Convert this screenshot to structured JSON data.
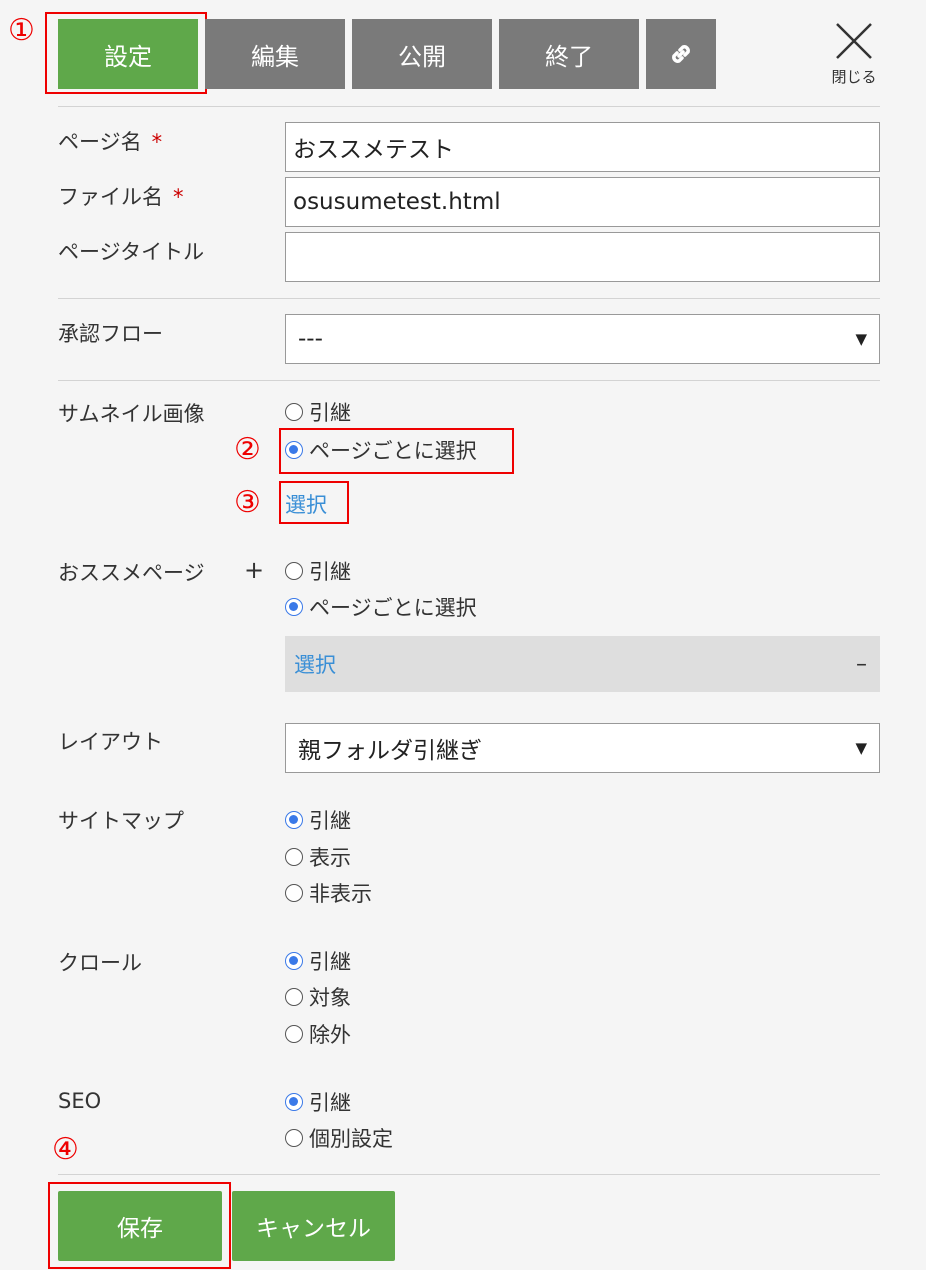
{
  "tabs": {
    "settings": "設定",
    "edit": "編集",
    "publish": "公開",
    "end": "終了"
  },
  "close_label": "閉じる",
  "fields": {
    "page_name_label": "ページ名",
    "page_name_value": "おススメテスト",
    "file_name_label": "ファイル名",
    "file_name_value": "osusumetest.html",
    "page_title_label": "ページタイトル",
    "page_title_value": "",
    "required_mark": "*"
  },
  "approval": {
    "label": "承認フロー",
    "value": "---"
  },
  "thumbnail": {
    "label": "サムネイル画像",
    "opt_inherit": "引継",
    "opt_per_page": "ページごとに選択",
    "select_link": "選択"
  },
  "recommend": {
    "label": "おススメページ",
    "plus": "+",
    "opt_inherit": "引継",
    "opt_per_page": "ページごとに選択",
    "select_link": "選択",
    "minus": "–"
  },
  "layout": {
    "label": "レイアウト",
    "value": "親フォルダ引継ぎ"
  },
  "sitemap": {
    "label": "サイトマップ",
    "opt_inherit": "引継",
    "opt_show": "表示",
    "opt_hide": "非表示"
  },
  "crawl": {
    "label": "クロール",
    "opt_inherit": "引継",
    "opt_target": "対象",
    "opt_exclude": "除外"
  },
  "seo": {
    "label": "SEO",
    "opt_inherit": "引継",
    "opt_custom": "個別設定"
  },
  "buttons": {
    "save": "保存",
    "cancel": "キャンセル"
  },
  "callouts": {
    "c1": "①",
    "c2": "②",
    "c3": "③",
    "c4": "④"
  },
  "colors": {
    "active_tab": "#5fa84a",
    "inactive_tab": "#7a7a7a",
    "accent_red": "#ee0000",
    "radio_blue": "#3a79e8",
    "link_blue": "#3a8fd6"
  },
  "icons": {
    "link_tab": "chain-link-icon",
    "close": "close-x-icon"
  }
}
